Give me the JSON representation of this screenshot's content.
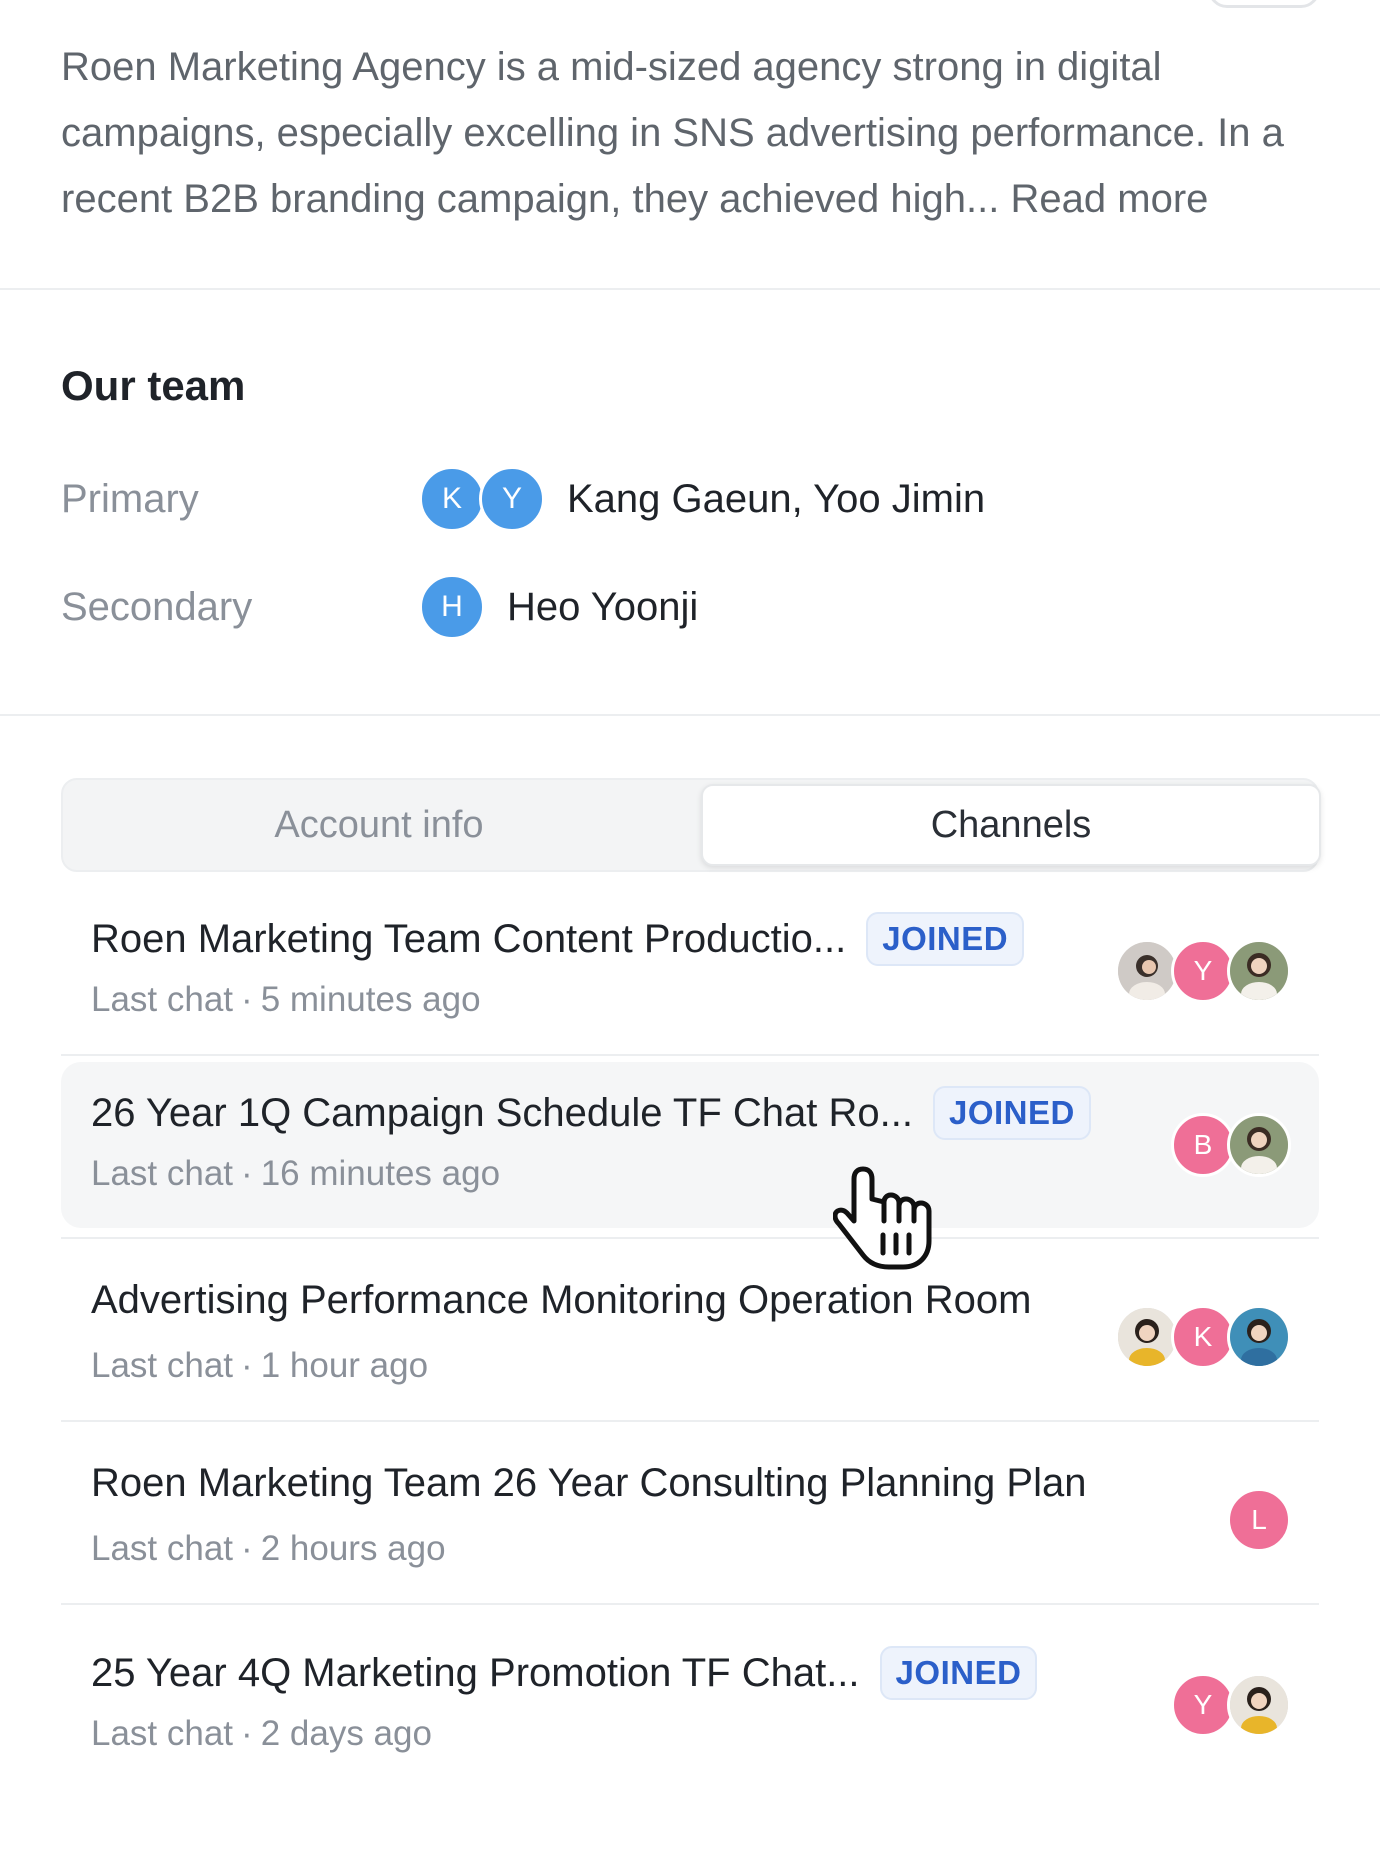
{
  "description": {
    "text": "Roen Marketing Agency is a mid-sized agency strong in digital campaigns, especially excelling in SNS advertising performance. In a recent B2B branding campaign, they achieved high...",
    "read_more": "Read more"
  },
  "team": {
    "title": "Our team",
    "primary": {
      "label": "Primary",
      "avatars": [
        "K",
        "Y"
      ],
      "names": "Kang Gaeun, Yoo Jimin"
    },
    "secondary": {
      "label": "Secondary",
      "avatars": [
        "H"
      ],
      "names": "Heo Yoonji"
    }
  },
  "tabs": {
    "account_info": "Account info",
    "channels": "Channels",
    "active": "channels"
  },
  "channels": [
    {
      "title": "Roen Marketing Team Content Productio...",
      "badge": "JOINED",
      "last_chat_label": "Last chat",
      "last_chat_time": "5 minutes ago",
      "avatars": [
        "photo",
        "Y",
        "photo"
      ]
    },
    {
      "title": "26 Year 1Q Campaign Schedule TF Chat Ro...",
      "badge": "JOINED",
      "last_chat_label": "Last chat",
      "last_chat_time": "16 minutes ago",
      "avatars": [
        "B",
        "photo"
      ]
    },
    {
      "title": "Advertising Performance Monitoring Operation Room",
      "badge": "",
      "last_chat_label": "Last chat",
      "last_chat_time": "1 hour ago",
      "avatars": [
        "photo",
        "K",
        "photo"
      ]
    },
    {
      "title": "Roen Marketing Team 26 Year Consulting Planning Plan",
      "badge": "",
      "last_chat_label": "Last chat",
      "last_chat_time": "2 hours ago",
      "avatars": [
        "L"
      ]
    },
    {
      "title": "25 Year 4Q Marketing Promotion TF Chat...",
      "badge": "JOINED",
      "last_chat_label": "Last chat",
      "last_chat_time": "2 days ago",
      "avatars": [
        "Y",
        "photo"
      ]
    }
  ],
  "colors": {
    "avatar_blue": "#4a9be8",
    "avatar_pink": "#ef6f97",
    "badge_text": "#2b5fc9",
    "badge_bg": "#eef3fc"
  },
  "icons": {
    "cursor": "hand-pointer-icon"
  }
}
